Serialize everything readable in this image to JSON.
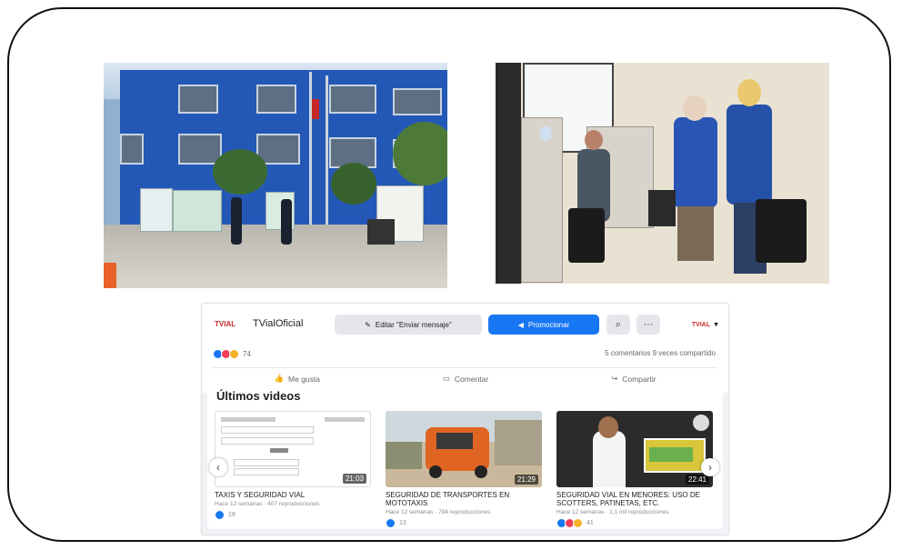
{
  "colors": {
    "fb_blue": "#1877f2",
    "like": "#1877f2",
    "love": "#f33e58",
    "haha": "#f7b125"
  },
  "page": {
    "logo": "TVIAL",
    "name": "TVialOficial",
    "edit_button": "Editar \"Enviar mensaje\"",
    "promote_button": "Promocionar",
    "search_icon": "search-icon",
    "more_icon": "more-icon",
    "page_logo_small": "TVIAL"
  },
  "post": {
    "reaction_count": "74",
    "comments_shares": "5 comentarios  9 veces compartido",
    "like": "Me gusta",
    "comment": "Comentar",
    "share": "Compartir"
  },
  "latest_videos": {
    "title": "Últimos videos",
    "items": [
      {
        "title": "TAXIS Y SEGURIDAD VIAL",
        "meta": "Hace 12 semanas · 407 reproducciones",
        "duration": "21:03",
        "reactions": "19"
      },
      {
        "title": "SEGURIDAD DE TRANSPORTES EN MOTOTAXIS",
        "meta": "Hace 12 semanas · 784 reproducciones",
        "duration": "21:29",
        "reactions": "13"
      },
      {
        "title": "SEGURIDAD VIAL EN MENORES: USO DE SCOTTERS, PATINETAS, ETC.",
        "meta": "Hace 12 semanas · 1,1 mil reproducciones",
        "duration": "22:41",
        "reactions": "41"
      }
    ]
  }
}
